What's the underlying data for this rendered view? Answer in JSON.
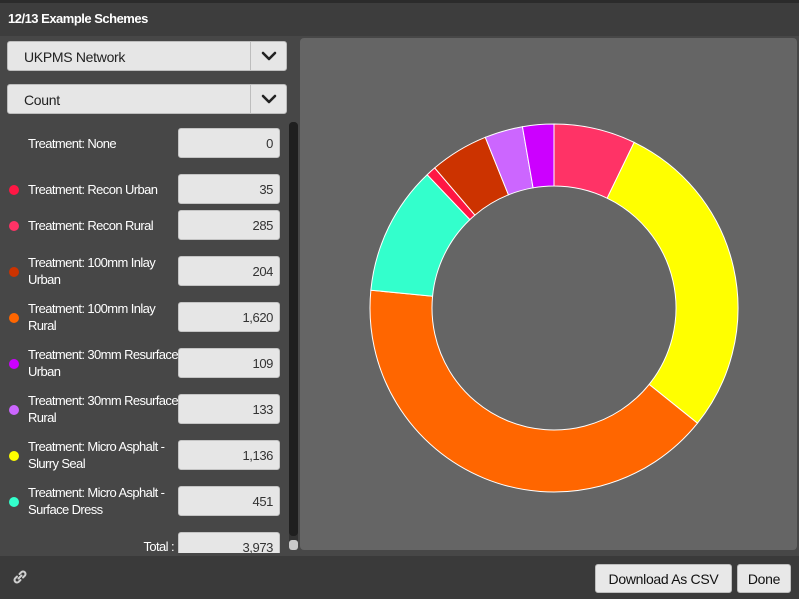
{
  "window": {
    "title": "12/13 Example Schemes"
  },
  "filters": {
    "network": "UKPMS Network",
    "measure": "Count"
  },
  "legend": {
    "items": [
      {
        "label": "Treatment: None",
        "value": "0",
        "color": null
      },
      {
        "label": "Treatment: Recon Urban",
        "value": "35",
        "color": "#ff1744"
      },
      {
        "label": "Treatment: Recon Rural",
        "value": "285",
        "color": "#ff3366"
      },
      {
        "label": "Treatment: 100mm Inlay Urban",
        "value": "204",
        "color": "#cc3300"
      },
      {
        "label": "Treatment: 100mm Inlay Rural",
        "value": "1,620",
        "color": "#ff6600"
      },
      {
        "label": "Treatment: 30mm Resurface Urban",
        "value": "109",
        "color": "#cc00ff"
      },
      {
        "label": "Treatment: 30mm Resurface Rural",
        "value": "133",
        "color": "#cc66ff"
      },
      {
        "label": "Treatment: Micro Asphalt - Slurry Seal",
        "value": "1,136",
        "color": "#ffff00"
      },
      {
        "label": "Treatment: Micro Asphalt - Surface Dress",
        "value": "451",
        "color": "#33ffcc"
      }
    ],
    "total_label": "Total :",
    "total_value": "3,973"
  },
  "chart_data": {
    "type": "pie",
    "donut": true,
    "title": "",
    "slices": [
      {
        "name": "Treatment: None",
        "value": 0,
        "color": "#999999"
      },
      {
        "name": "Treatment: Recon Rural",
        "value": 285,
        "color": "#ff3366"
      },
      {
        "name": "Treatment: Micro Asphalt - Slurry Seal",
        "value": 1136,
        "color": "#ffff00"
      },
      {
        "name": "Treatment: 100mm Inlay Rural",
        "value": 1620,
        "color": "#ff6600"
      },
      {
        "name": "Treatment: Micro Asphalt - Surface Dress",
        "value": 451,
        "color": "#33ffcc"
      },
      {
        "name": "Treatment: Recon Urban",
        "value": 35,
        "color": "#ff1744"
      },
      {
        "name": "Treatment: 100mm Inlay Urban",
        "value": 204,
        "color": "#cc3300"
      },
      {
        "name": "Treatment: 30mm Resurface Rural",
        "value": 133,
        "color": "#cc66ff"
      },
      {
        "name": "Treatment: 30mm Resurface Urban",
        "value": 109,
        "color": "#cc00ff"
      }
    ]
  },
  "footer": {
    "link_icon": "link-icon",
    "download_label": "Download As CSV",
    "done_label": "Done"
  }
}
